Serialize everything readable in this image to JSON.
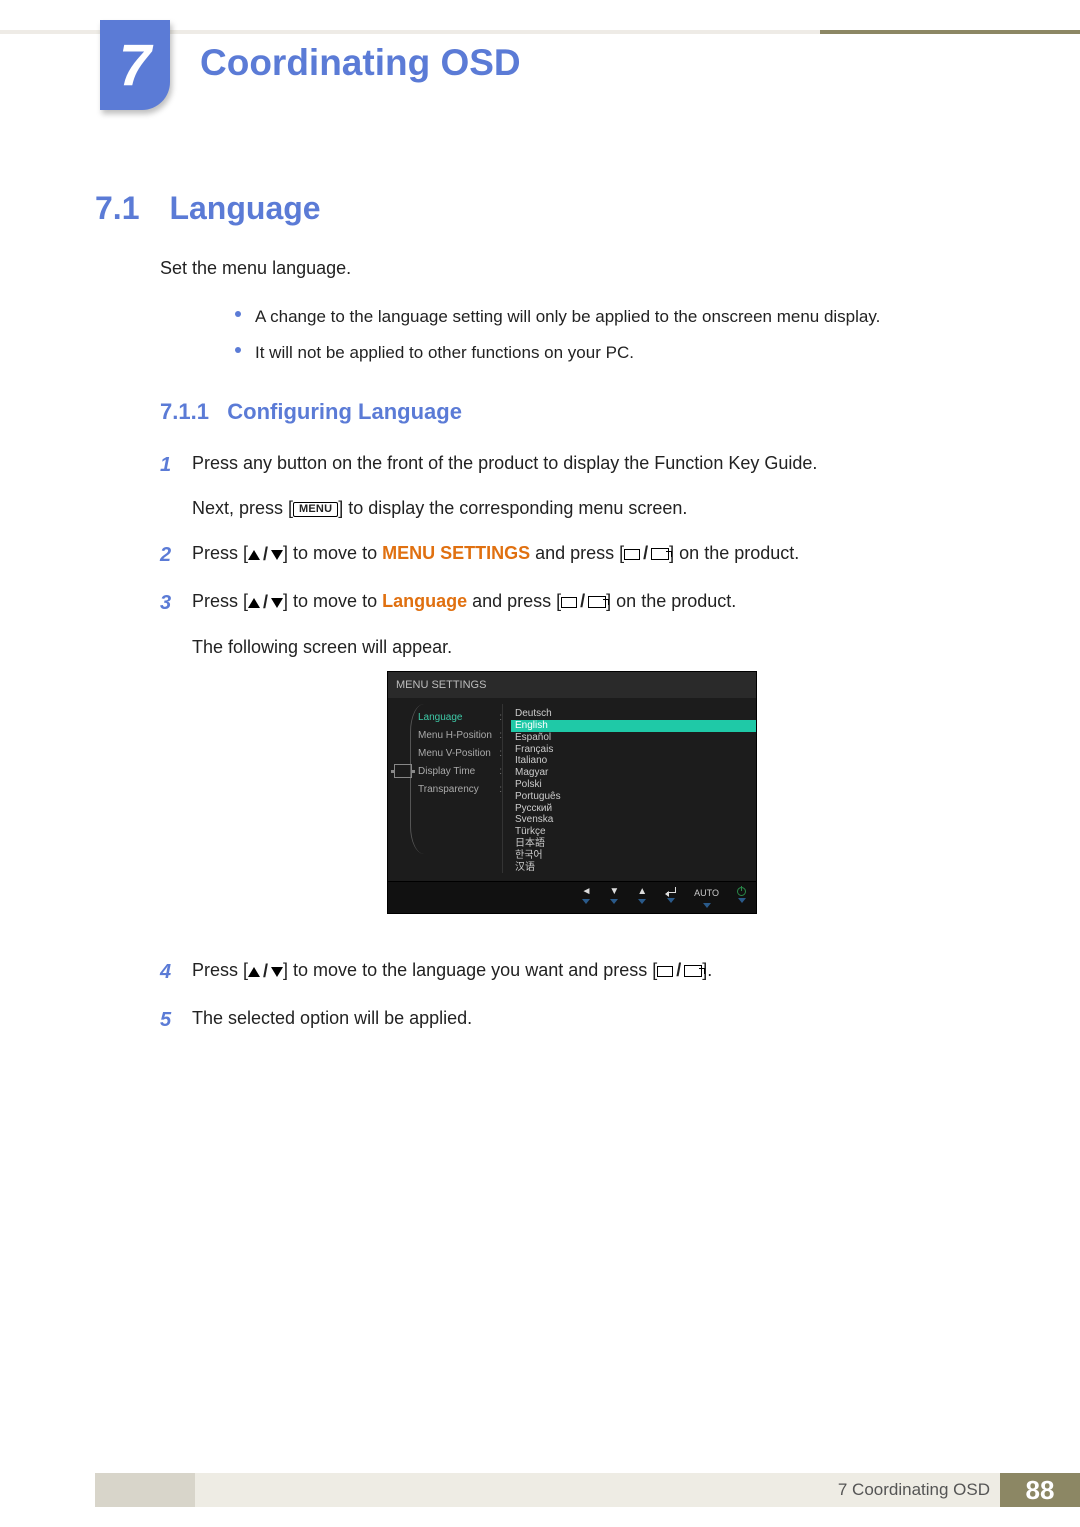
{
  "header": {
    "chapter_number": "7",
    "chapter_title": "Coordinating OSD"
  },
  "section": {
    "number": "7.1",
    "title": "Language",
    "intro": "Set the menu language.",
    "notes": [
      "A change to the language setting will only be applied to the onscreen menu display.",
      "It will not be applied to other functions on your PC."
    ]
  },
  "subsection": {
    "number": "7.1.1",
    "title": "Configuring Language"
  },
  "steps": {
    "s1": {
      "n": "1",
      "text": "Press any button on the front of the product to display the Function Key Guide.",
      "cont_a": "Next, press [",
      "cont_menu": "MENU",
      "cont_b": "] to display the corresponding menu screen."
    },
    "s2": {
      "n": "2",
      "a": "Press [",
      "b": "] to move to ",
      "hi": "MENU SETTINGS",
      "c": " and press [",
      "d": "] on the product."
    },
    "s3": {
      "n": "3",
      "a": "Press [",
      "b": "] to move to ",
      "hi": "Language",
      "c": " and press [",
      "d": "] on the product.",
      "cont": "The following screen will appear."
    },
    "s4": {
      "n": "4",
      "a": "Press [",
      "b": "] to move to the language you want and press [",
      "c": "]."
    },
    "s5": {
      "n": "5",
      "text": "The selected option will be applied."
    }
  },
  "osd": {
    "title": "MENU SETTINGS",
    "menu": {
      "language": "Language",
      "h_pos": "Menu H-Position",
      "v_pos": "Menu V-Position",
      "display_time": "Display Time",
      "transparency": "Transparency"
    },
    "languages": [
      "Deutsch",
      "English",
      "Español",
      "Français",
      "Italiano",
      "Magyar",
      "Polski",
      "Português",
      "Русский",
      "Svenska",
      "Türkçe",
      "日本語",
      "한국어",
      "汉语"
    ],
    "selected_index": 1,
    "footer_auto": "AUTO"
  },
  "footer": {
    "label": "7 Coordinating OSD",
    "page": "88"
  }
}
